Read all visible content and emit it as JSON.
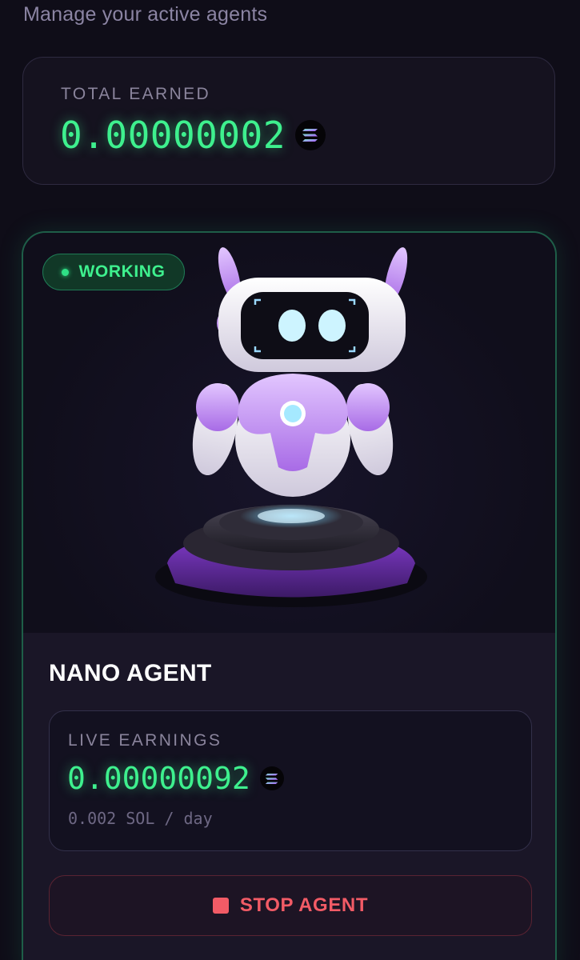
{
  "header": {
    "subtitle": "Manage your active agents"
  },
  "total": {
    "label": "TOTAL EARNED",
    "value": "0.00000002",
    "currency_icon": "solana-icon"
  },
  "agent": {
    "status": "WORKING",
    "status_color": "#3ef08e",
    "image_icon": "robot-illustration",
    "name": "NANO AGENT",
    "live_label": "LIVE EARNINGS",
    "live_value": "0.00000092",
    "rate": "0.002 SOL / day",
    "stop_label": "STOP AGENT",
    "stop_color": "#f25b66"
  },
  "colors": {
    "accent_green": "#3ef08e",
    "card_border_green": "#1e5e48",
    "background": "#0f0d18",
    "danger": "#f25b66"
  }
}
